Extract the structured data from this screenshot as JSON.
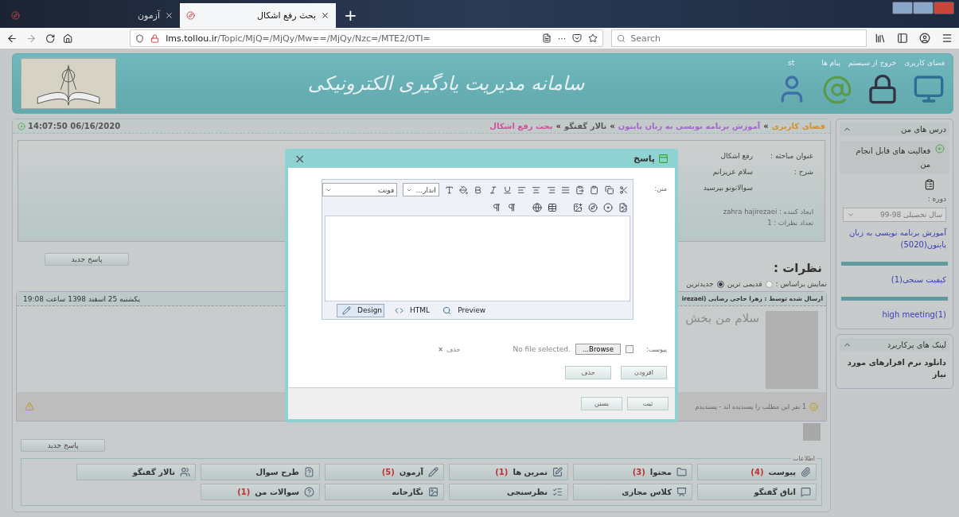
{
  "browser": {
    "tabs": [
      {
        "title": "بحث رفع اشکال",
        "selected": true
      },
      {
        "title": "آزمون",
        "selected": false
      }
    ],
    "new_tab": "+",
    "url_host": "lms.tollou.ir",
    "url_path": "/Topic/MjQ=/MjQy/Mw==/MjQy/Nzc=/MTE2/OTI=",
    "more": "···",
    "search_placeholder": "Search"
  },
  "header": {
    "links": [
      "فضای کاربری",
      "خروج از سیستم",
      "پیام ها"
    ],
    "user": "st",
    "logo_text": "سامانه مدیریت یادگیری الکترونیکی"
  },
  "breadcrumb": {
    "separator": "»",
    "items": [
      {
        "label": "فضای کاربری",
        "color": "#d4902c"
      },
      {
        "label": "آموزش برنامه نویسی به زبان پایتون",
        "color": "#a466cc"
      },
      {
        "label": "تالار گفتگو",
        "color": "#5a5a5a"
      },
      {
        "label": "بحث رفع اشکال",
        "color": "#d24f9c"
      }
    ]
  },
  "clock": "14:07:50 06/16/2020",
  "topic": {
    "fields": [
      {
        "label": "عنوان مباحثه :",
        "lines": [
          "رفع اشکال"
        ]
      },
      {
        "label": "شرح :",
        "lines": [
          "سلام عزیزانم",
          "سوالاتونو بپرسید"
        ]
      }
    ],
    "creator": "ایجاد کننده : zahra hajirezaei",
    "count": "تعداد نظرات : 1"
  },
  "new_reply_button": "پاسخ جدید",
  "comments_title": "نظرات :",
  "sort": {
    "label": "نمایش براساس :",
    "options": [
      {
        "label": "قدیمی ترین",
        "selected": false
      },
      {
        "label": "جدیدترین",
        "selected": true
      }
    ]
  },
  "comment": {
    "author": "ارسال شده توسط : زهرا حاجی رضایی (irezaei",
    "date": "یکشنبه 25 اسفند 1398 ساعت 19:08",
    "body": "سلام من بخش",
    "likes": "1 نفر این مطلب را پسندیده اند - پسندیدم"
  },
  "new_reply_button_2": "پاسخ جدید",
  "info": {
    "legend": "اطلاعات",
    "items": [
      {
        "label": "پیوست",
        "count": "(4)"
      },
      {
        "label": "محتوا",
        "count": "(3)"
      },
      {
        "label": "تمرین ها",
        "count": "(1)"
      },
      {
        "label": "آزمون",
        "count": "(5)"
      },
      {
        "label": "طرح سوال"
      },
      {
        "label": "تالار گفتگو"
      },
      {
        "label": "اتاق گفتگو"
      },
      {
        "label": "کلاس مجازی"
      },
      {
        "label": "نظرسنجی"
      },
      {
        "label": "نگارخانه"
      },
      {
        "label": "سوالات من",
        "count": "(1)"
      }
    ]
  },
  "sidebar": {
    "courses": {
      "title": "درس های من",
      "activities": "فعالیت های قابل انجام من",
      "term_label": "دوره :",
      "term_value": "سال تحصیلی 98-99",
      "links": [
        "آموزش برنامه نویسی به زبان پایتون(5020)",
        "کیفیت سنجی(1)",
        "high meeting(1)"
      ]
    },
    "useful": {
      "title": "لینک های پرکاربرد",
      "links": [
        "دانلود نرم افزارهای مورد نیاز"
      ]
    }
  },
  "dialog": {
    "title": "پاسخ",
    "close": "×",
    "text_label": "متن:",
    "font_select": "فونت",
    "size_select": "اندار...",
    "modes": [
      {
        "label": "Preview",
        "selected": false
      },
      {
        "label": "HTML",
        "selected": false
      },
      {
        "label": "Design",
        "selected": true
      }
    ],
    "attach_label": "پیوست:",
    "attach_checked": false,
    "browse": "Browse...",
    "no_file": "No file selected.",
    "remove_link": "حذف",
    "remove_mark": "×",
    "add_button": "افزودن",
    "delete_button": "حذف",
    "submit_button": "ثبت",
    "close_button": "بستن"
  }
}
